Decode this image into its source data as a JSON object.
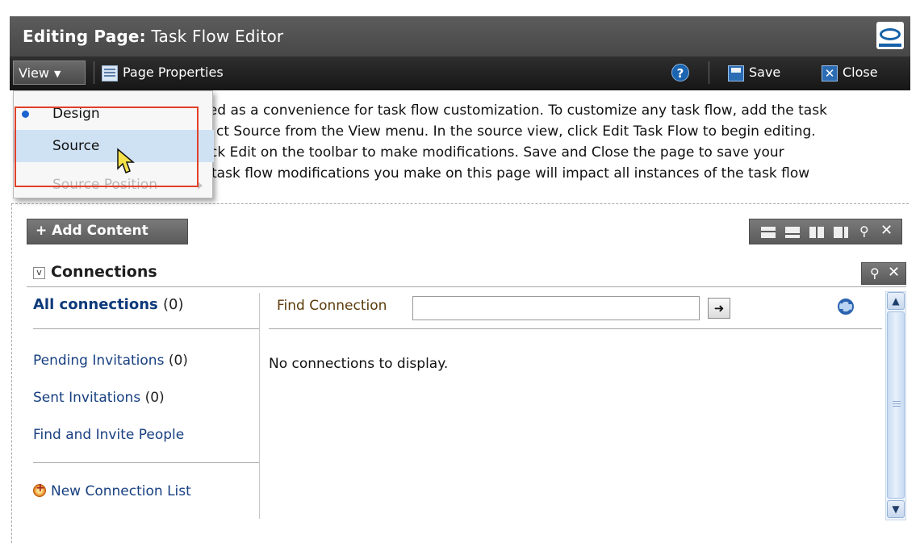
{
  "titlebar": {
    "prefix": "Editing Page:",
    "page_name": "Task Flow Editor"
  },
  "toolbar": {
    "view_label": "View",
    "page_properties_label": "Page Properties",
    "save_label": "Save",
    "close_label": "Close"
  },
  "view_menu": {
    "items": [
      {
        "label": "Design",
        "selected": true
      },
      {
        "label": "Source",
        "hovered": true
      },
      {
        "label": "Source Position",
        "disabled": true
      }
    ]
  },
  "info_lines": [
    "ded as a convenience for task flow customization. To customize any task flow, add the task",
    "ct Source from the View menu. In the source view, click Edit Task Flow to begin editing.",
    "ck Edit on the toolbar to make modifications. Save and Close the page to save your",
    " task flow modifications you make on this page will impact all instances of the task flow"
  ],
  "content": {
    "add_content_label": "+ Add Content"
  },
  "connections": {
    "title": "Connections",
    "all_label": "All connections",
    "all_count": "(0)",
    "pending_label": "Pending Invitations",
    "pending_count": "(0)",
    "sent_label": "Sent Invitations",
    "sent_count": "(0)",
    "find_invite_label": "Find and Invite People",
    "new_list_label": "New Connection List",
    "find_label": "Find Connection",
    "find_value": "",
    "empty_message": "No connections to display."
  },
  "icons": {
    "help": "help-icon",
    "save": "save-icon",
    "close": "close-icon",
    "refresh": "refresh-icon",
    "go": "arrow-right-icon"
  },
  "colors": {
    "title_bar": "#4f4f4f",
    "toolbar": "#222222",
    "menu_hover": "#cfe2f4",
    "highlight_box": "#e0412a",
    "link": "#173f80"
  }
}
